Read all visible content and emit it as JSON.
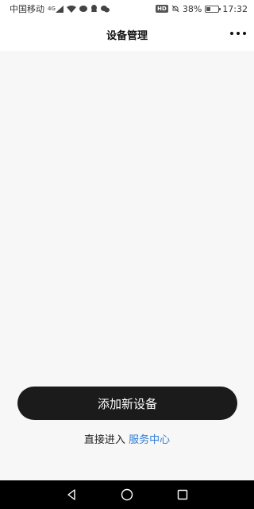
{
  "status_bar": {
    "carrier": "中国移动",
    "network": "4G",
    "battery_percent": "38%",
    "battery_level": 0.38,
    "time": "17:32",
    "hd_label": "HD",
    "icons": [
      "signal-icon",
      "wifi-icon",
      "chat-icon",
      "qq-icon",
      "wechat-icon",
      "hd-icon",
      "mute-icon",
      "battery-icon"
    ]
  },
  "header": {
    "title": "设备管理",
    "more_icon": "more-icon"
  },
  "main": {
    "add_button_label": "添加新设备",
    "service_prefix": "直接进入",
    "service_link": "服务中心",
    "link_color": "#2f7fd6",
    "button_color": "#1b1b1b"
  },
  "nav_bar": {
    "icons": [
      "back-icon",
      "home-icon",
      "recents-icon"
    ]
  }
}
